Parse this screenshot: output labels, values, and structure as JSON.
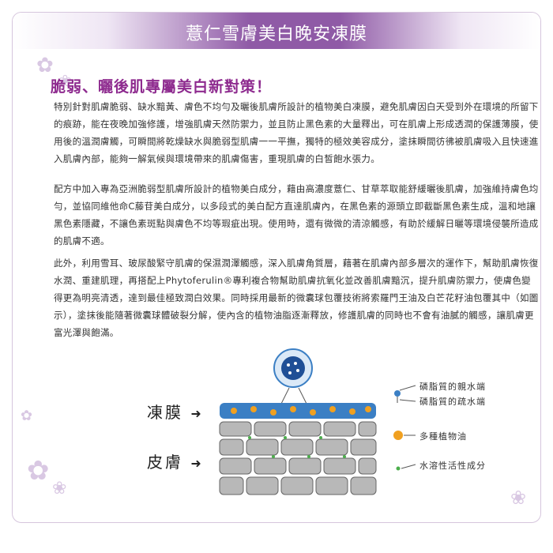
{
  "banner": {
    "title": "薏仁雪膚美白晚安凍膜"
  },
  "headline": "脆弱、曬後肌專屬美白新對策！",
  "paragraphs": [
    "特別針對肌膚脆弱、缺水黯黃、膚色不均勻及曬後肌膚所設計的植物美白凍膜，避免肌膚因白天受到外在環境的所留下的痕跡，能在夜晚加強修護，增強肌膚天然防禦力，並且防止黑色素的大量釋出，可在肌膚上形成透潤的保護薄膜，使用後的溫潤膚觸，可瞬間將乾燥缺水與脆弱型肌膚一一平撫，獨特的極效美容成分，塗抹瞬間彷彿被肌膚吸入且快速進入肌膚內部，能夠一解氣候與環境帶來的肌膚傷害，重現肌膚的白皙飽水張力。",
    "配方中加入專為亞洲脆弱型肌膚所設計的植物美白成分，藉由高濃度薏仁、甘草萃取能舒緩曬後肌膚，加強維持膚色均勻，並協同維他命C藤苷美白成分，以多段式的美白配方直達肌膚內，在黑色素的源頭立即截斷黑色素生成，溫和地讓黑色素隱藏，不讓色素斑點與膚色不均等瑕疵出現。使用時，還有微微的清涼觸感，有助於緩解日曬等環境侵襲所造成的肌膚不適。",
    "此外，利用雪耳、玻尿酸緊守肌膚的保濕潤澤觸感，深入肌膚角質層，藉著在肌膚內部多層次的運作下，幫助肌膚恢復水潤、重建肌理，再搭配上Phytoferulin®專利複合物幫助肌膚抗氧化並改善肌膚黯沉，提升肌膚防禦力，使膚色變得更為明亮清透，達到最佳極致潤白效果。同時採用最新的微囊球包覆技術將索羅門王油及白芒花籽油包覆其中（如圖示），塗抹後能隨著微囊球體破裂分解，使內含的植物油脂逐漸釋放，修護肌膚的同時也不會有油膩的觸感，讓肌膚更富光澤與飽滿。"
  ],
  "diagram": {
    "label_film": "凍膜",
    "label_skin": "皮膚",
    "arrow": "➜",
    "legend": [
      "磷脂質的親水端",
      "磷脂質的疏水端",
      "多種植物油",
      "水溶性活性成分"
    ]
  },
  "colors": {
    "accent": "#8e2b8f",
    "banner": "#8f5aa6",
    "film": "#3b7fc4",
    "oil": "#f0a020",
    "active": "#4cae4c"
  }
}
